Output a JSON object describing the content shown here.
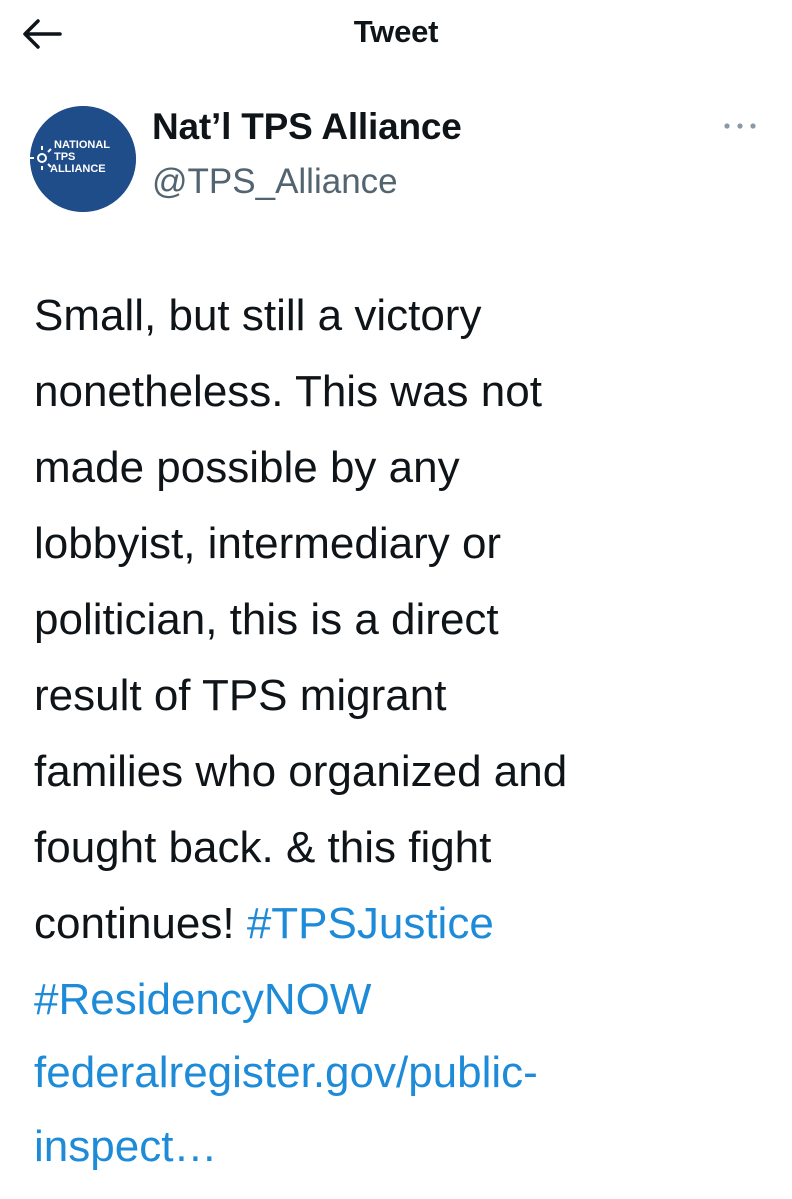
{
  "header": {
    "title": "Tweet",
    "back_icon": "arrow-left-icon"
  },
  "author": {
    "avatar_line1": "NATIONAL",
    "avatar_line2": "TPS",
    "avatar_line3": "ALLIANCE",
    "avatar_color": "#1f4d8a",
    "name": "Nat’l TPS Alliance",
    "handle": "@TPS_Alliance",
    "more_icon": "more-horizontal-icon"
  },
  "tweet": {
    "text_lines": [
      "Small, but still a victory",
      "nonetheless. This was not",
      "made possible by any",
      "lobbyist, intermediary or",
      "politician, this is a direct",
      "result of TPS migrant",
      "families who organized and",
      "fought back. & this fight",
      "continues! "
    ],
    "hashtags": [
      "#TPSJustice",
      "#ResidencyNOW"
    ],
    "link_line1": "federalregister.gov/public-",
    "link_line2": "inspect…",
    "link_color": "#1d8bd8"
  }
}
